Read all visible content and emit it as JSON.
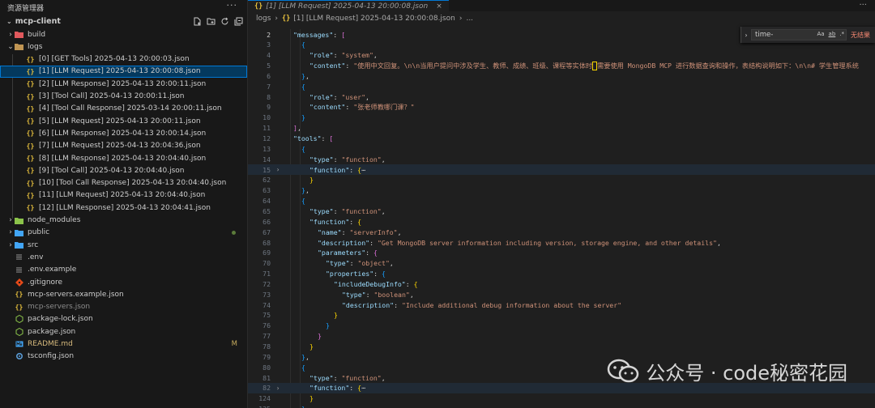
{
  "sidebar": {
    "header": "资源管理器",
    "more": "···",
    "root": "mcp-client",
    "items": [
      {
        "label": "build",
        "kind": "folder",
        "chev": "›",
        "color": "#e0595d"
      },
      {
        "label": "logs",
        "kind": "folder-open",
        "chev": "⌄",
        "color": "#c09553"
      },
      {
        "label": "[0] [GET Tools] 2025-04-13 20:00:03.json",
        "kind": "json"
      },
      {
        "label": "[1] [LLM Request] 2025-04-13 20:00:08.json",
        "kind": "json",
        "selected": true
      },
      {
        "label": "[2] [LLM Response] 2025-04-13 20:00:11.json",
        "kind": "json"
      },
      {
        "label": "[3] [Tool Call] 2025-04-13 20:00:11.json",
        "kind": "json"
      },
      {
        "label": "[4] [Tool Call Response] 2025-03-14 20:00:11.json",
        "kind": "json"
      },
      {
        "label": "[5] [LLM Request] 2025-04-13 20:00:11.json",
        "kind": "json"
      },
      {
        "label": "[6] [LLM Response] 2025-04-13 20:00:14.json",
        "kind": "json"
      },
      {
        "label": "[7] [LLM Request] 2025-04-13 20:04:36.json",
        "kind": "json"
      },
      {
        "label": "[8] [LLM Response] 2025-04-13 20:04:40.json",
        "kind": "json"
      },
      {
        "label": "[9] [Tool Call] 2025-04-13 20:04:40.json",
        "kind": "json"
      },
      {
        "label": "[10] [Tool Call Response] 2025-04-13 20:04:40.json",
        "kind": "json"
      },
      {
        "label": "[11] [LLM Request] 2025-04-13 20:04:40.json",
        "kind": "json"
      },
      {
        "label": "[12] [LLM Response] 2025-04-13 20:04:41.json",
        "kind": "json"
      },
      {
        "label": "node_modules",
        "kind": "folder",
        "chev": "›",
        "color": "#8bc34a"
      },
      {
        "label": "public",
        "kind": "folder",
        "chev": "›",
        "color": "#42a5f5",
        "dot": true
      },
      {
        "label": "src",
        "kind": "folder",
        "chev": "›",
        "color": "#42a5f5"
      },
      {
        "label": ".env",
        "kind": "env"
      },
      {
        "label": ".env.example",
        "kind": "env"
      },
      {
        "label": ".gitignore",
        "kind": "git"
      },
      {
        "label": "mcp-servers.example.json",
        "kind": "json"
      },
      {
        "label": "mcp-servers.json",
        "kind": "json",
        "dim": true
      },
      {
        "label": "package-lock.json",
        "kind": "npm"
      },
      {
        "label": "package.json",
        "kind": "npm"
      },
      {
        "label": "README.md",
        "kind": "md",
        "badge": "M",
        "accent": true
      },
      {
        "label": "tsconfig.json",
        "kind": "ts"
      }
    ]
  },
  "editor": {
    "tab_label": "[1] [LLM Request] 2025-04-13 20:00:08.json",
    "tab_close": "×",
    "tab_more": "···",
    "breadcrumb": {
      "folder": "logs",
      "file": "[1] [LLM Request] 2025-04-13 20:00:08.json",
      "tail": "..."
    },
    "find": {
      "query": "time-",
      "opt_case": "Aa",
      "opt_word": "ab",
      "opt_regex": ".*",
      "result": "无结果"
    },
    "lines": [
      {
        "n": "2",
        "cur": true,
        "indent": 1,
        "seg": [
          [
            "s",
            "k",
            "\"messages\""
          ],
          [
            "p",
            ": "
          ],
          [
            "b2",
            "["
          ]
        ]
      },
      {
        "n": "3",
        "indent": 2,
        "seg": [
          [
            "b3",
            "{"
          ]
        ]
      },
      {
        "n": "4",
        "indent": 3,
        "seg": [
          [
            "k",
            "\"role\""
          ],
          [
            "p",
            ": "
          ],
          [
            "s",
            "\"system\""
          ],
          [
            "p",
            ","
          ]
        ]
      },
      {
        "n": "5",
        "indent": 3,
        "caret": true,
        "seg": [
          [
            "k",
            "\"content\""
          ],
          [
            "p",
            ": "
          ],
          [
            "s",
            "\"使用中文回复。\\n\\n当用户提问中涉及学生、教师、成绩、班级、课程等实体时"
          ],
          [
            "caret",
            ""
          ],
          [
            "s",
            "需要使用 MongoDB MCP 进行数据查询和操作，表结构说明如下：\\n\\n# 学生管理系统"
          ]
        ]
      },
      {
        "n": "6",
        "indent": 2,
        "seg": [
          [
            "b3",
            "}"
          ],
          [
            "p",
            ","
          ]
        ]
      },
      {
        "n": "7",
        "indent": 2,
        "seg": [
          [
            "b3",
            "{"
          ]
        ]
      },
      {
        "n": "8",
        "indent": 3,
        "seg": [
          [
            "k",
            "\"role\""
          ],
          [
            "p",
            ": "
          ],
          [
            "s",
            "\"user\""
          ],
          [
            "p",
            ","
          ]
        ]
      },
      {
        "n": "9",
        "indent": 3,
        "seg": [
          [
            "k",
            "\"content\""
          ],
          [
            "p",
            ": "
          ],
          [
            "s",
            "\"张老师教哪门课？\""
          ]
        ]
      },
      {
        "n": "10",
        "indent": 2,
        "seg": [
          [
            "b3",
            "}"
          ]
        ]
      },
      {
        "n": "11",
        "indent": 1,
        "seg": [
          [
            "b2",
            "]"
          ],
          [
            "p",
            ","
          ]
        ]
      },
      {
        "n": "12",
        "indent": 1,
        "seg": [
          [
            "k",
            "\"tools\""
          ],
          [
            "p",
            ": "
          ],
          [
            "b2",
            "["
          ]
        ]
      },
      {
        "n": "13",
        "indent": 2,
        "seg": [
          [
            "b3",
            "{"
          ]
        ]
      },
      {
        "n": "14",
        "indent": 3,
        "seg": [
          [
            "k",
            "\"type\""
          ],
          [
            "p",
            ": "
          ],
          [
            "s",
            "\"function\""
          ],
          [
            "p",
            ","
          ]
        ]
      },
      {
        "n": "15",
        "indent": 3,
        "fold": "›",
        "hl": true,
        "seg": [
          [
            "k",
            "\"function\""
          ],
          [
            "p",
            ": "
          ],
          [
            "b1",
            "{"
          ],
          [
            "p",
            "⋯"
          ]
        ]
      },
      {
        "n": "62",
        "indent": 3,
        "seg": [
          [
            "b1",
            "}"
          ]
        ]
      },
      {
        "n": "63",
        "indent": 2,
        "seg": [
          [
            "b3",
            "}"
          ],
          [
            "p",
            ","
          ]
        ]
      },
      {
        "n": "64",
        "indent": 2,
        "seg": [
          [
            "b3",
            "{"
          ]
        ]
      },
      {
        "n": "65",
        "indent": 3,
        "seg": [
          [
            "k",
            "\"type\""
          ],
          [
            "p",
            ": "
          ],
          [
            "s",
            "\"function\""
          ],
          [
            "p",
            ","
          ]
        ]
      },
      {
        "n": "66",
        "indent": 3,
        "seg": [
          [
            "k",
            "\"function\""
          ],
          [
            "p",
            ": "
          ],
          [
            "b1",
            "{"
          ]
        ]
      },
      {
        "n": "67",
        "indent": 4,
        "seg": [
          [
            "k",
            "\"name\""
          ],
          [
            "p",
            ": "
          ],
          [
            "s",
            "\"serverInfo\""
          ],
          [
            "p",
            ","
          ]
        ]
      },
      {
        "n": "68",
        "indent": 4,
        "seg": [
          [
            "k",
            "\"description\""
          ],
          [
            "p",
            ": "
          ],
          [
            "s",
            "\"Get MongoDB server information including version, storage engine, and other details\""
          ],
          [
            "p",
            ","
          ]
        ]
      },
      {
        "n": "69",
        "indent": 4,
        "seg": [
          [
            "k",
            "\"parameters\""
          ],
          [
            "p",
            ": "
          ],
          [
            "b2",
            "{"
          ]
        ]
      },
      {
        "n": "70",
        "indent": 5,
        "seg": [
          [
            "k",
            "\"type\""
          ],
          [
            "p",
            ": "
          ],
          [
            "s",
            "\"object\""
          ],
          [
            "p",
            ","
          ]
        ]
      },
      {
        "n": "71",
        "indent": 5,
        "seg": [
          [
            "k",
            "\"properties\""
          ],
          [
            "p",
            ": "
          ],
          [
            "b3",
            "{"
          ]
        ]
      },
      {
        "n": "72",
        "indent": 6,
        "seg": [
          [
            "k",
            "\"includeDebugInfo\""
          ],
          [
            "p",
            ": "
          ],
          [
            "b1",
            "{"
          ]
        ]
      },
      {
        "n": "73",
        "indent": 7,
        "seg": [
          [
            "k",
            "\"type\""
          ],
          [
            "p",
            ": "
          ],
          [
            "s",
            "\"boolean\""
          ],
          [
            "p",
            ","
          ]
        ]
      },
      {
        "n": "74",
        "indent": 7,
        "seg": [
          [
            "k",
            "\"description\""
          ],
          [
            "p",
            ": "
          ],
          [
            "s",
            "\"Include additional debug information about the server\""
          ]
        ]
      },
      {
        "n": "75",
        "indent": 6,
        "seg": [
          [
            "b1",
            "}"
          ]
        ]
      },
      {
        "n": "76",
        "indent": 5,
        "seg": [
          [
            "b3",
            "}"
          ]
        ]
      },
      {
        "n": "77",
        "indent": 4,
        "seg": [
          [
            "b2",
            "}"
          ]
        ]
      },
      {
        "n": "78",
        "indent": 3,
        "seg": [
          [
            "b1",
            "}"
          ]
        ]
      },
      {
        "n": "79",
        "indent": 2,
        "seg": [
          [
            "b3",
            "}"
          ],
          [
            "p",
            ","
          ]
        ]
      },
      {
        "n": "80",
        "indent": 2,
        "seg": [
          [
            "b3",
            "{"
          ]
        ]
      },
      {
        "n": "81",
        "indent": 3,
        "seg": [
          [
            "k",
            "\"type\""
          ],
          [
            "p",
            ": "
          ],
          [
            "s",
            "\"function\""
          ],
          [
            "p",
            ","
          ]
        ]
      },
      {
        "n": "82",
        "indent": 3,
        "fold": "›",
        "hl": true,
        "seg": [
          [
            "k",
            "\"function\""
          ],
          [
            "p",
            ": "
          ],
          [
            "b1",
            "{"
          ],
          [
            "p",
            "⋯"
          ]
        ]
      },
      {
        "n": "124",
        "indent": 3,
        "seg": [
          [
            "b1",
            "}"
          ]
        ]
      },
      {
        "n": "125",
        "indent": 2,
        "seg": [
          [
            "b3",
            "}"
          ],
          [
            "p",
            ","
          ]
        ]
      }
    ]
  },
  "watermark": "公众号 · code秘密花园",
  "colors": {
    "accent": "#0078d4",
    "selection": "#04395e",
    "json_icon": "#e8c13d",
    "modified": "#c7ac5d"
  }
}
